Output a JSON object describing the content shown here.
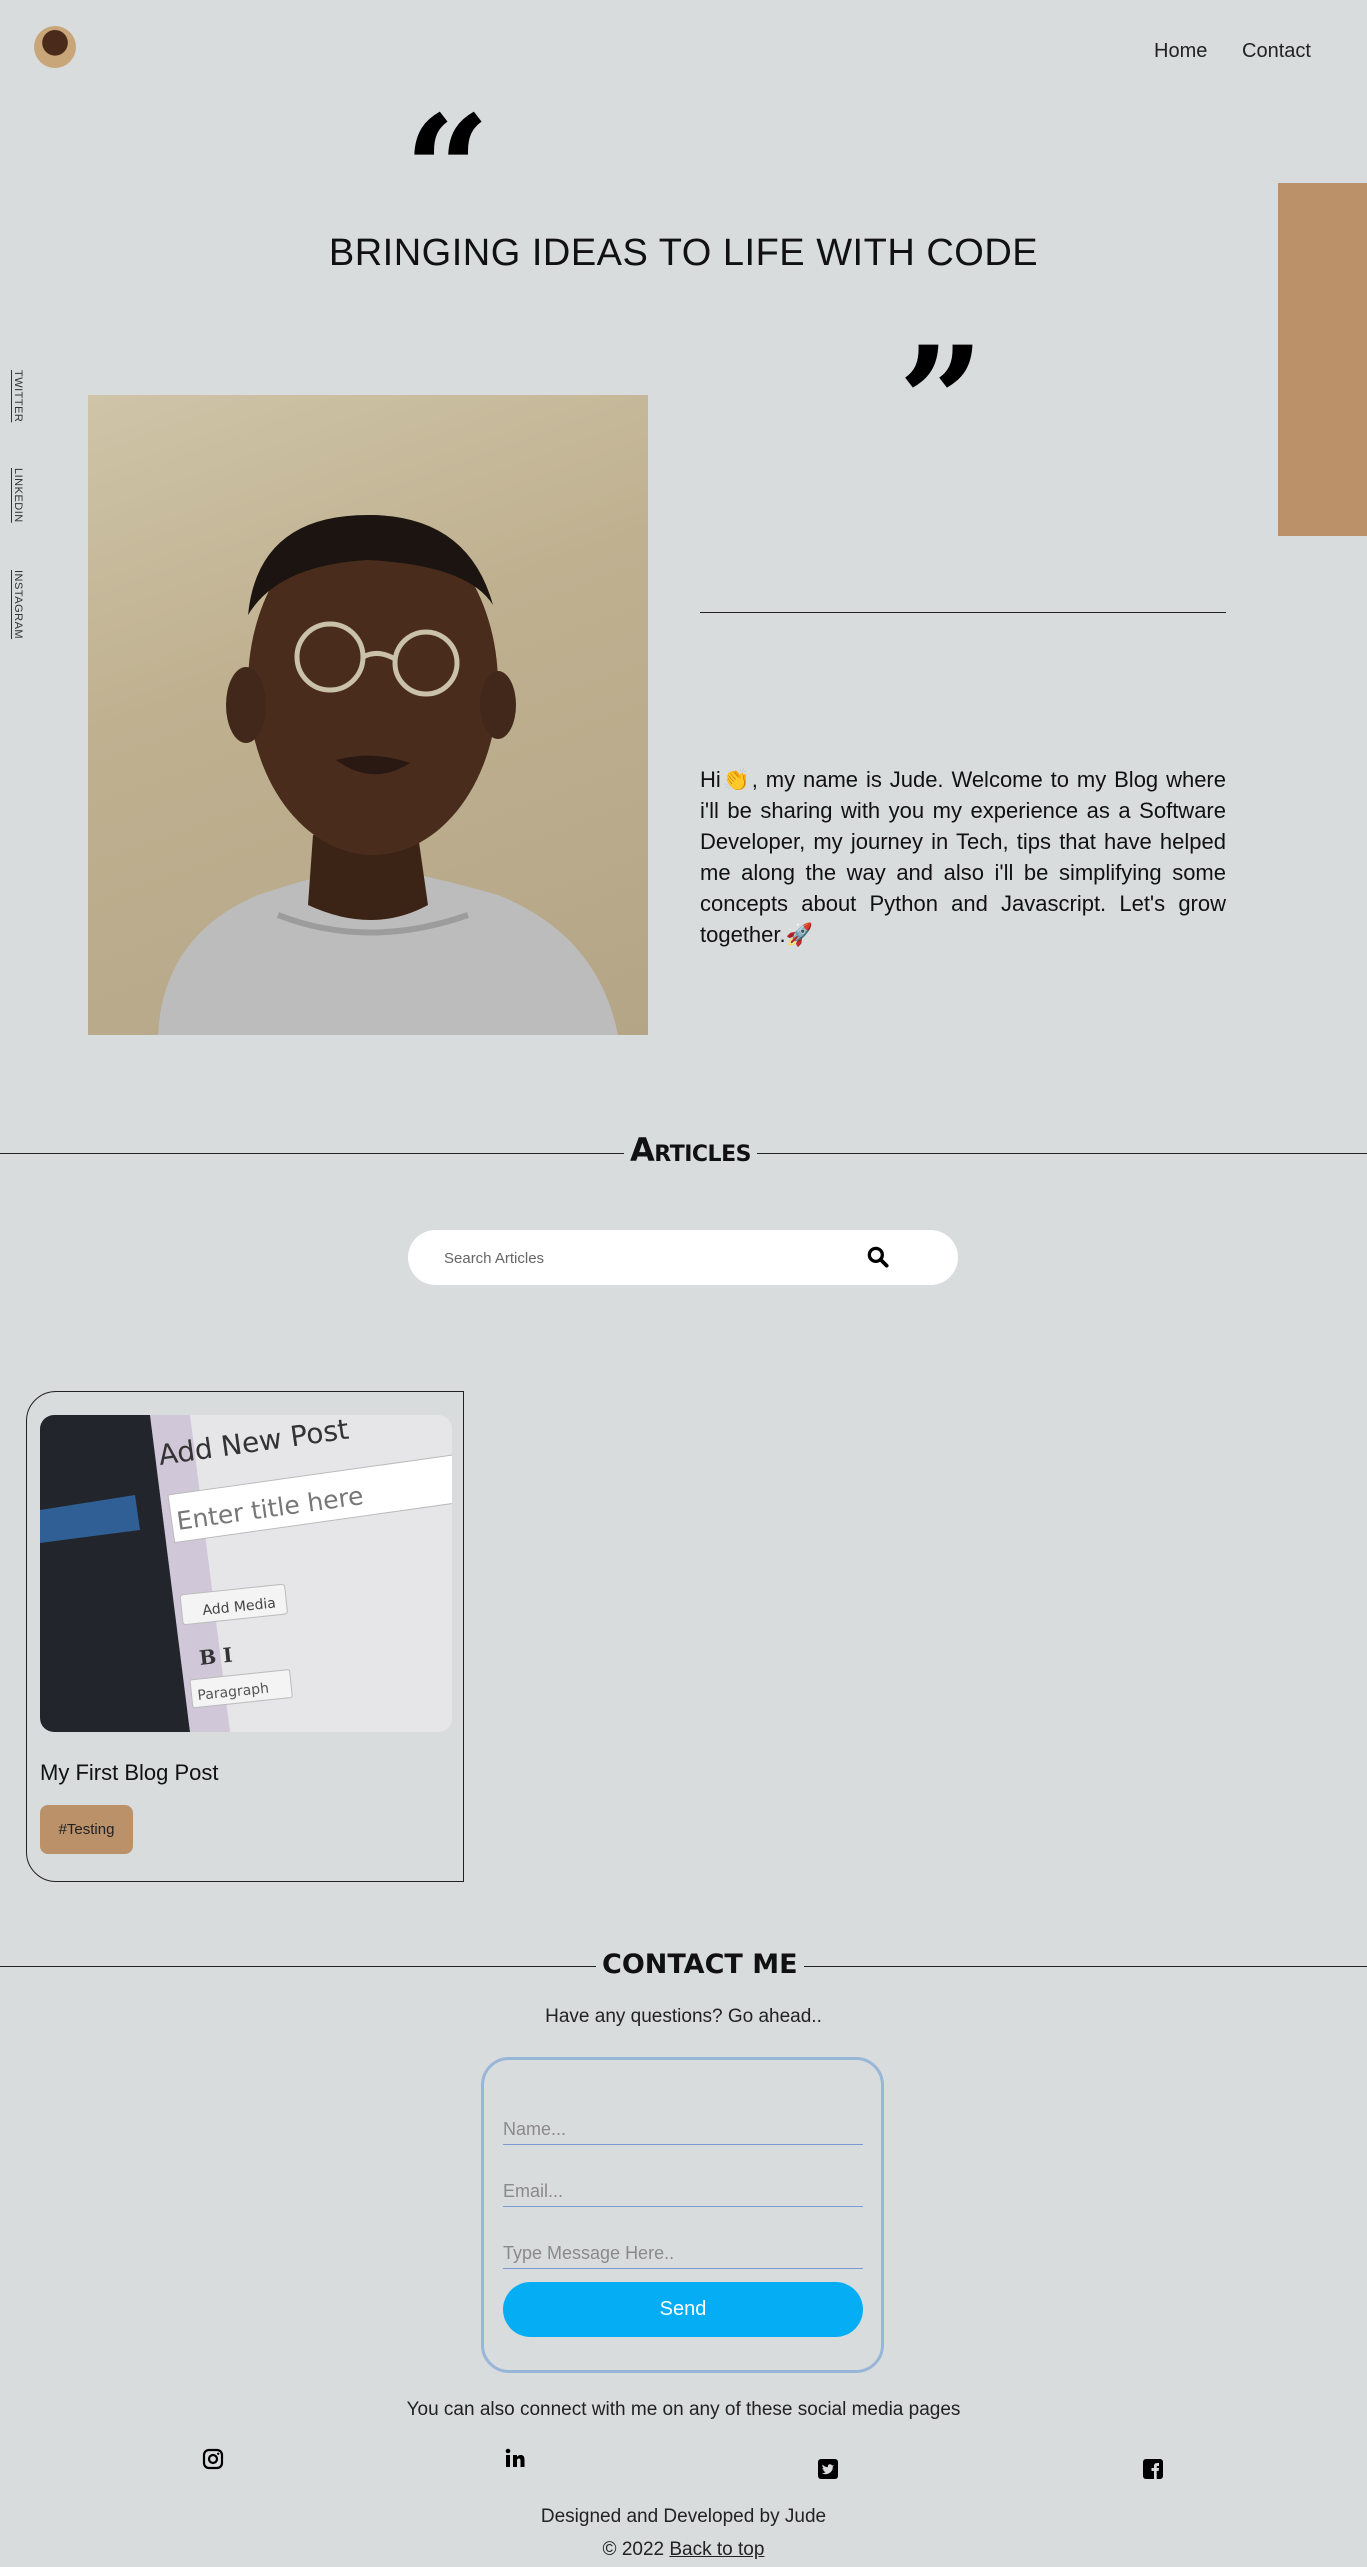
{
  "nav": {
    "links": [
      "Home",
      "Contact"
    ]
  },
  "hero": {
    "title": "BRINGING IDEAS TO LIFE WITH CODE",
    "open_quote": "“",
    "close_quote": "”",
    "intro": "Hi👏, my name is Jude. Welcome to my Blog where i'll be sharing with you my experience as a Software Developer, my journey in Tech, tips that have helped me along the way and also i'll be simplifying some concepts about Python and Javascript. Let's grow together.🚀"
  },
  "side_links": [
    "TWITTER",
    "LINKEDIN",
    "INSTAGRAM"
  ],
  "articles": {
    "title": "Articles",
    "search_placeholder": "Search Articles",
    "items": [
      {
        "title": "My First Blog Post",
        "tag": "#Testing",
        "thumb": {
          "header": "Add New Post",
          "title_field": "Enter title here",
          "add_media": "Add Media",
          "paragraph": "Paragraph"
        }
      }
    ]
  },
  "contact": {
    "title": "CONTACT ME",
    "subtitle": "Have any questions? Go ahead..",
    "name_placeholder": "Name...",
    "email_placeholder": "Email...",
    "message_placeholder": "Type Message Here..",
    "send_label": "Send",
    "social_text": "You can also connect with me on any of these social media pages"
  },
  "footer": {
    "credit": "Designed and Developed by Jude",
    "copyright": "© 2022",
    "back_to_top": "Back to top"
  },
  "colors": {
    "background": "#d9dcdd",
    "accent": "#bb916a",
    "send_button": "#05adf5",
    "form_border": "#97b6d8"
  },
  "icons": [
    "avatar",
    "open-quote-icon",
    "close-quote-icon",
    "search-icon",
    "instagram-icon",
    "linkedin-icon",
    "twitter-icon",
    "facebook-icon"
  ]
}
